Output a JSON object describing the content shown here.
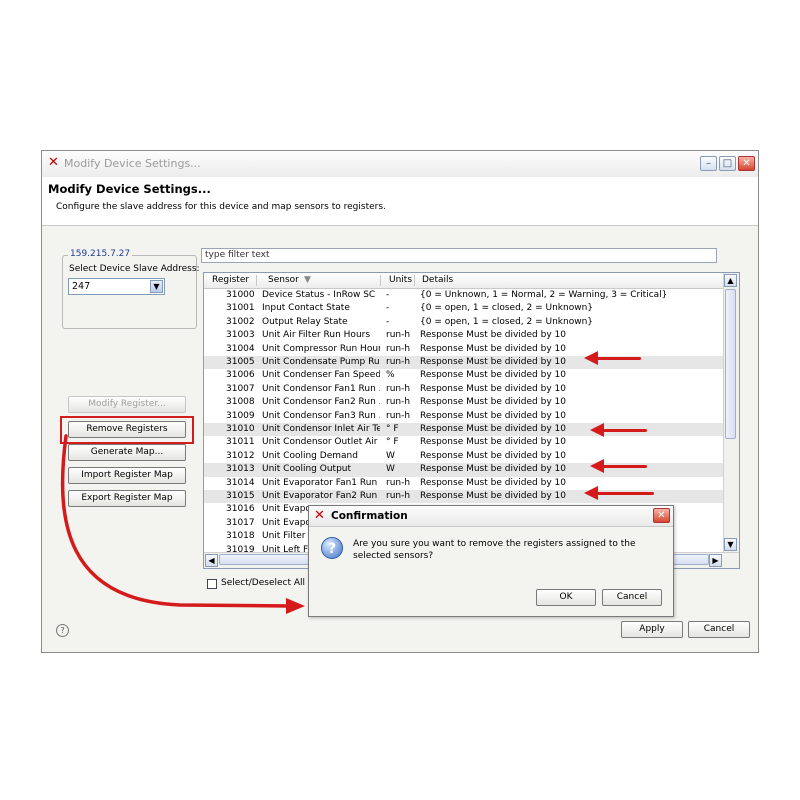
{
  "window": {
    "title": "Modify Device Settings...",
    "header_title": "Modify Device Settings...",
    "header_subtitle": "Configure the slave address for this device and map sensors to registers."
  },
  "device": {
    "ip": "159.215.7.27",
    "slave_address_label": "Select Device Slave Address:",
    "slave_address_value": "247"
  },
  "buttons": {
    "modify_register": "Modify Register...",
    "remove_registers": "Remove Registers",
    "generate_map": "Generate Map...",
    "import_register_map": "Import Register Map",
    "export_register_map": "Export Register Map",
    "apply": "Apply",
    "cancel": "Cancel"
  },
  "filter": {
    "text": "type filter text"
  },
  "table": {
    "headers": [
      "Register",
      "Sensor",
      "Units",
      "Details"
    ],
    "rows": [
      {
        "register": "31000",
        "sensor": "Device Status - InRow SC",
        "units": "-",
        "details": "{0 = Unknown, 1 = Normal, 2 = Warning, 3 = Critical}",
        "selected": false
      },
      {
        "register": "31001",
        "sensor": "Input Contact State",
        "units": "-",
        "details": "{0 = open, 1 = closed, 2 = Unknown}",
        "selected": false
      },
      {
        "register": "31002",
        "sensor": "Output Relay State",
        "units": "-",
        "details": "{0 = open, 1 = closed, 2 = Unknown}",
        "selected": false
      },
      {
        "register": "31003",
        "sensor": "Unit Air Filter Run Hours",
        "units": "run-h",
        "details": "Response Must be divided by 10",
        "selected": false
      },
      {
        "register": "31004",
        "sensor": "Unit Compressor Run Hours",
        "units": "run-h",
        "details": "Response Must be divided by 10",
        "selected": false
      },
      {
        "register": "31005",
        "sensor": "Unit Condensate Pump Ru...",
        "units": "run-h",
        "details": "Response Must be divided by 10",
        "selected": true
      },
      {
        "register": "31006",
        "sensor": "Unit Condenser Fan Speed",
        "units": "%",
        "details": "Response Must be divided by 10",
        "selected": false
      },
      {
        "register": "31007",
        "sensor": "Unit Condensor Fan1 Run ...",
        "units": "run-h",
        "details": "Response Must be divided by 10",
        "selected": false
      },
      {
        "register": "31008",
        "sensor": "Unit Condensor Fan2 Run ...",
        "units": "run-h",
        "details": "Response Must be divided by 10",
        "selected": false
      },
      {
        "register": "31009",
        "sensor": "Unit Condensor Fan3 Run ...",
        "units": "run-h",
        "details": "Response Must be divided by 10",
        "selected": false
      },
      {
        "register": "31010",
        "sensor": "Unit Condensor Inlet Air Te...",
        "units": "° F",
        "details": "Response Must be divided by 10",
        "selected": true
      },
      {
        "register": "31011",
        "sensor": "Unit Condensor Outlet Air ...",
        "units": "° F",
        "details": "Response Must be divided by 10",
        "selected": false
      },
      {
        "register": "31012",
        "sensor": "Unit Cooling Demand",
        "units": "W",
        "details": "Response Must be divided by 10",
        "selected": false
      },
      {
        "register": "31013",
        "sensor": "Unit Cooling Output",
        "units": "W",
        "details": "Response Must be divided by 10",
        "selected": true
      },
      {
        "register": "31014",
        "sensor": "Unit Evaporator Fan1 Run ...",
        "units": "run-h",
        "details": "Response Must be divided by 10",
        "selected": false
      },
      {
        "register": "31015",
        "sensor": "Unit Evaporator Fan2 Run ...",
        "units": "run-h",
        "details": "Response Must be divided by 10",
        "selected": true
      },
      {
        "register": "31016",
        "sensor": "Unit Evapor",
        "units": "",
        "details": "",
        "selected": false
      },
      {
        "register": "31017",
        "sensor": "Unit Evapor",
        "units": "",
        "details": "",
        "selected": false
      },
      {
        "register": "31018",
        "sensor": "Unit Filter D",
        "units": "",
        "details": "",
        "selected": false
      },
      {
        "register": "31019",
        "sensor": "Unit Left Fa",
        "units": "",
        "details": "",
        "selected": false
      }
    ]
  },
  "select_all": {
    "label": "Select/Deselect All",
    "checked": false
  },
  "dialog": {
    "title": "Confirmation",
    "message": "Are you sure you want to remove the registers assigned to the selected sensors?",
    "ok": "OK",
    "cancel": "Cancel"
  },
  "colors": {
    "annotation_red": "#d41a1a",
    "selection_gray": "#e6e6e6",
    "link_blue": "#1f3c9a"
  },
  "icons": [
    "app-x-icon",
    "minimize-icon",
    "maximize-icon",
    "close-icon",
    "dropdown-arrow-icon",
    "sort-arrow-icon",
    "question-icon",
    "help-icon",
    "red-arrow-icon"
  ]
}
